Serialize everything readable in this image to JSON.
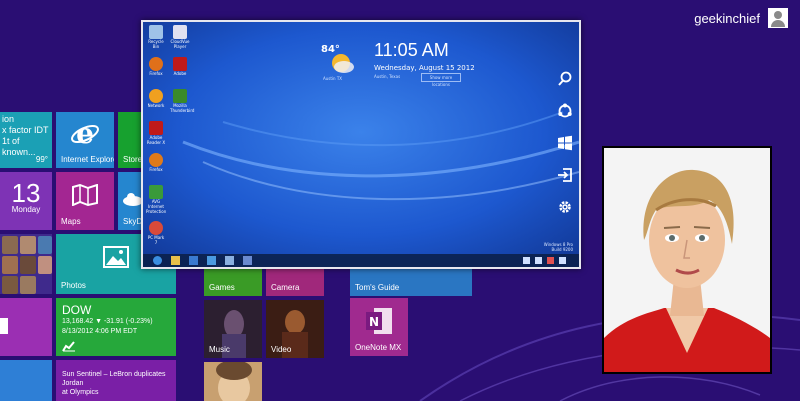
{
  "user": {
    "name": "geekinchief"
  },
  "tiles": {
    "weather": {
      "text": "ion\nx factor IDT\n1t of known...",
      "temp": "99°"
    },
    "ie": {
      "label": "Internet Explorer"
    },
    "store": {
      "label": "Store"
    },
    "calendar": {
      "day": "13",
      "weekday": "Monday"
    },
    "maps": {
      "label": "Maps"
    },
    "skydrive": {
      "label": "SkyD"
    },
    "photos": {
      "label": "Photos"
    },
    "dow": {
      "title": "DOW",
      "line1": "13,168.42 ▼ -31.91 (-0.23%)",
      "line2": "8/13/2012 4:06 PM EDT"
    },
    "news": {
      "text": "Sun Sentinel – LeBron duplicates Jordan\nat Olympics"
    },
    "games": {
      "label": "Games"
    },
    "camera": {
      "label": "Camera"
    },
    "toms": {
      "label": "Tom's Guide"
    },
    "music": {
      "label": "Music"
    },
    "video": {
      "label": "Video"
    },
    "onenote": {
      "label": "OneNote MX"
    }
  },
  "desktop": {
    "icons": [
      {
        "label": "Recycle Bin",
        "color": "#9fc3e8"
      },
      {
        "label": "CloudVue Player",
        "color": "#e0e0f0"
      },
      {
        "label": "Firefox",
        "color": "#e0701a"
      },
      {
        "label": "Adobe",
        "color": "#c01a1a"
      },
      {
        "label": "Network",
        "color": "#f0a020"
      },
      {
        "label": "Mozilla Thunderbird",
        "color": "#3a8a2a"
      },
      {
        "label": "Adobe Reader X",
        "color": "#c01a1a"
      },
      {
        "label": "Firefox",
        "color": "#e07a1a"
      },
      {
        "label": "AVG Internet Protection",
        "color": "#3a9a3a"
      },
      {
        "label": "PC Mark 7",
        "color": "#d94a3a"
      }
    ],
    "time": "11:05 AM",
    "date": "Wednesday, August 15 2012",
    "location": "Austin, Texas",
    "location_button": "Show more locations",
    "temperature": "84°",
    "temp_location": "Austin TX",
    "watermark": "Windows 8 Pro\nBuild 9200"
  },
  "charms": [
    "search-icon",
    "share-icon",
    "start-icon",
    "devices-icon",
    "settings-icon"
  ],
  "colors": {
    "background": "#2a0e73",
    "desktop": "#1c55c9"
  }
}
